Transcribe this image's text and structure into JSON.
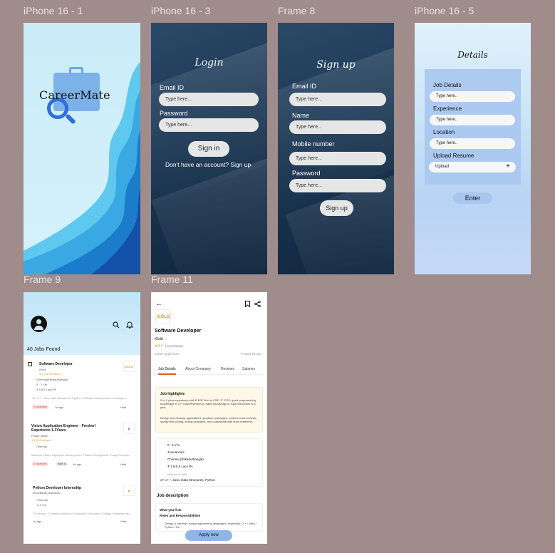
{
  "canvas": {
    "background": "#a08c8a"
  },
  "frames": {
    "f1": {
      "label": "iPhone 16 - 1",
      "brand": "CareerMate"
    },
    "f3": {
      "label": "iPhone 16 - 3",
      "title": "Login",
      "email_label": "Email ID",
      "email_placeholder": "Type here...",
      "password_label": "Password",
      "password_placeholder": "Type here...",
      "signin_button": "Sign in",
      "signup_prompt": "Don't have an account? Sign up"
    },
    "f8": {
      "label": "Frame 8",
      "title": "Sign up",
      "email_label": "Email ID",
      "email_placeholder": "Type here...",
      "name_label": "Name",
      "name_placeholder": "Type here...",
      "mobile_label": "Mobile number",
      "mobile_placeholder": "Type here...",
      "password_label": "Password",
      "password_placeholder": "Type here...",
      "signup_button": "Sign up"
    },
    "f5": {
      "label": "iPhone 16 - 5",
      "title": "Details",
      "job_label": "Job Details",
      "job_placeholder": "Type here..",
      "exp_label": "Experience",
      "exp_placeholder": "Type here..",
      "loc_label": "Location",
      "loc_placeholder": "Type here..",
      "resume_label": "Upload Resume",
      "upload_text": "Upload",
      "plus": "+",
      "enter_button": "Enter"
    },
    "f9": {
      "label": "Frame 9",
      "jobs_found": "40 Jobs Found",
      "cards": [
        {
          "title": "Software Developer",
          "company": "iGold",
          "rating": "4.4 (14 Reviews)",
          "location": "Chennai(Ekkaduthangal)",
          "experience": "0 - 1 Yrs",
          "salary": "3.5-5.5 Lacs PA",
          "skills": "c#, c++, Java, Data Structures, Python, Software development, Developm...",
          "tag1": "4 vacancies",
          "posted": "1d ago",
          "hide": "Hide",
          "logo": "iGOLD"
        },
        {
          "title": "Vision Application Engineer - Fresher/ Experience 1-3Years",
          "company": "Future Vision",
          "rating": "4.1 (5 Reviews)",
          "location": "Chennai",
          "skills": "Machine Vision, Algorithm Development, Pattern Recognition, Image Process...",
          "tag1": "3 vacancies",
          "tag2": "Walk in",
          "posted": "4d ago",
          "hide": "Hide"
        },
        {
          "title": "Python Developer Internship",
          "company": "Innovateziq Solutions",
          "location": "Chennai",
          "experience": "0-1 Yrs",
          "skills": "IT services, Computer science, Automation, Numbers, Coding, Database dev...",
          "posted": "4d ago",
          "hide": "Hide"
        }
      ]
    },
    "f11": {
      "label": "Frame 11",
      "logo": "iGOLD",
      "job_title": "Software Developer",
      "company": "iGold",
      "rating": "4.4",
      "reviews": "(14 reviews)",
      "applicants": "14597 applicants",
      "posted": "Posted 1d ago",
      "tabs": [
        "Job Details",
        "About Company",
        "Reviews",
        "Salaries"
      ],
      "highlights_title": "Job highlights",
      "highlights_1": "0 to 1 year experience with B.E/B.Tech in CSE, IT, ECE; good programming knowledge in C++/Java/Python/C#; basic knowledge in Data Structures is a plus",
      "highlights_2": "Design and develop applications, produce prototypes, perform code reviews, quality test coding, debug programs, and collaborate with team members",
      "experience": "0 - 1 Yrs",
      "vacancies": "4 vacancies",
      "location": "Chennai (Ekkaduthangal)",
      "salary": "₹ 3.5-5.5 Lacs PA",
      "must_have": "Must have skills",
      "skills": "c#, c++, Java, Data Structures, Python",
      "job_desc_title": "Job description",
      "what_do": "What you'll do",
      "roles": "Roles and Responsibilities",
      "bullet": "Design & develop using programming languages, especially C++ / Java / Python / C#",
      "apply_button": "Apply now"
    }
  },
  "colors": {
    "dark_bg": "#1d3956",
    "input_bg": "#e6e6e6",
    "accent": "#2e6fd8",
    "apply": "#8fb4e8"
  }
}
